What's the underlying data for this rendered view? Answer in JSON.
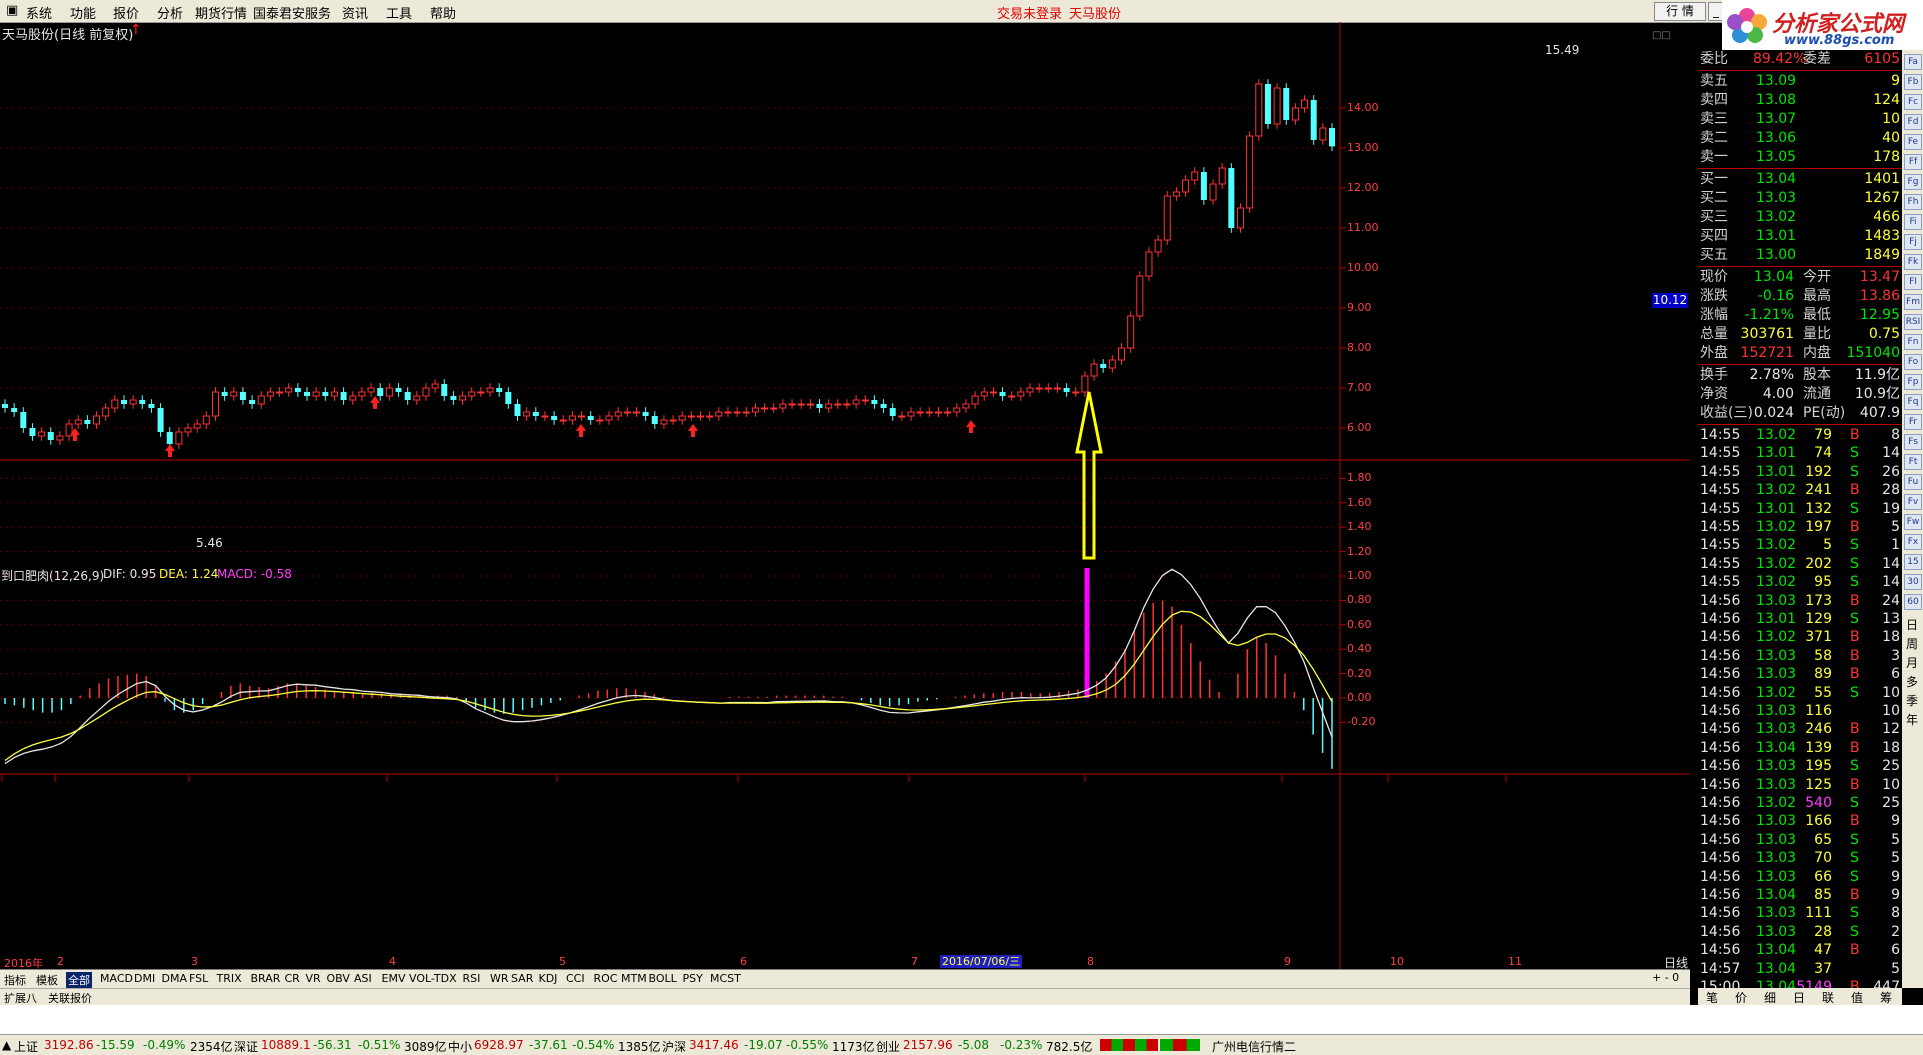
{
  "menu": {
    "items": [
      "系统",
      "功能",
      "报价",
      "分析",
      "期货行情",
      "国泰君安服务",
      "资讯",
      "工具",
      "帮助"
    ],
    "status_login": "交易未登录",
    "stock_short": "天马股份",
    "btn_quote": "行 情",
    "logo_main": "分析家公式网",
    "logo_url": "www.88gs.com"
  },
  "chart": {
    "title": "天马股份(日线 前复权)",
    "high_label": "15.49",
    "low_label": "5.46",
    "current_price_tag": "10.12",
    "price_axis": [
      "14.00",
      "13.00",
      "12.00",
      "11.00",
      "10.00",
      "9.00",
      "8.00",
      "7.00",
      "6.00"
    ],
    "macd_title": "到口肥肉(12,26,9)",
    "macd_dif": "DIF: 0.95",
    "macd_dea": "DEA: 1.24",
    "macd_macd": "MACD: -0.58",
    "macd_axis": [
      "1.80",
      "1.60",
      "1.40",
      "1.20",
      "1.00",
      "0.80",
      "0.60",
      "0.40",
      "0.20",
      "0.00",
      "-0.20"
    ],
    "date_axis": [
      "2016年",
      "2",
      "3",
      "4",
      "5",
      "6",
      "7",
      "8",
      "9",
      "10",
      "11"
    ],
    "date_cursor": "2016/07/06/三",
    "period": "日线"
  },
  "chart_data": {
    "type": "candlestick",
    "title": "天马股份(日线 前复权)",
    "price_range": [
      5.2,
      15.8
    ],
    "high": 15.49,
    "low": 5.46,
    "macd_params": "12,26,9",
    "dif": 0.95,
    "dea": 1.24,
    "macd": -0.58,
    "closes": [
      6.5,
      6.4,
      6.0,
      5.8,
      5.9,
      5.7,
      5.8,
      6.1,
      6.2,
      6.1,
      6.3,
      6.5,
      6.7,
      6.6,
      6.7,
      6.6,
      6.5,
      5.9,
      5.6,
      5.9,
      6.0,
      6.1,
      6.3,
      6.9,
      6.8,
      6.9,
      6.7,
      6.6,
      6.8,
      6.9,
      6.9,
      7.0,
      6.9,
      6.8,
      6.9,
      6.8,
      6.9,
      6.7,
      6.8,
      6.9,
      7.0,
      6.8,
      7.0,
      6.9,
      6.7,
      6.8,
      7.0,
      7.1,
      6.8,
      6.7,
      6.8,
      6.9,
      6.9,
      7.0,
      6.9,
      6.6,
      6.3,
      6.4,
      6.3,
      6.3,
      6.2,
      6.2,
      6.3,
      6.3,
      6.2,
      6.2,
      6.3,
      6.4,
      6.4,
      6.4,
      6.3,
      6.1,
      6.2,
      6.2,
      6.3,
      6.3,
      6.3,
      6.3,
      6.4,
      6.4,
      6.4,
      6.4,
      6.5,
      6.5,
      6.5,
      6.6,
      6.6,
      6.6,
      6.6,
      6.5,
      6.6,
      6.6,
      6.6,
      6.7,
      6.7,
      6.6,
      6.5,
      6.3,
      6.3,
      6.4,
      6.4,
      6.4,
      6.4,
      6.4,
      6.5,
      6.6,
      6.8,
      6.9,
      6.9,
      6.8,
      6.8,
      6.9,
      7.0,
      7.0,
      7.0,
      7.0,
      6.9,
      6.9,
      7.3,
      7.6,
      7.5,
      7.7,
      8.0,
      8.8,
      9.8,
      10.4,
      10.7,
      11.8,
      11.9,
      12.2,
      12.4,
      11.7,
      12.1,
      12.5,
      11.0,
      11.5,
      13.3,
      14.6,
      13.6,
      14.5,
      13.7,
      14.0,
      14.2,
      13.2,
      13.5,
      13.04
    ],
    "macd_hist": [
      -0.05,
      -0.06,
      -0.08,
      -0.1,
      -0.12,
      -0.12,
      -0.1,
      -0.05,
      0.02,
      0.08,
      0.12,
      0.16,
      0.18,
      0.19,
      0.2,
      0.18,
      0.1,
      -0.03,
      -0.1,
      -0.12,
      -0.1,
      -0.05,
      0,
      0.05,
      0.1,
      0.12,
      0.1,
      0.09,
      0.08,
      0.1,
      0.12,
      0.12,
      0.1,
      0.09,
      0.07,
      0.06,
      0.05,
      0.05,
      0.04,
      0.04,
      0.04,
      0.03,
      0.03,
      0.03,
      0.03,
      0.02,
      0.02,
      0.02,
      0.01,
      -0.03,
      -0.08,
      -0.1,
      -0.12,
      -0.13,
      -0.12,
      -0.1,
      -0.08,
      -0.06,
      -0.04,
      -0.02,
      0,
      0.02,
      0.04,
      0.06,
      0.07,
      0.08,
      0.08,
      0.07,
      0.05,
      0.03,
      0.01,
      0,
      0,
      0,
      0,
      0,
      0,
      0.01,
      0.01,
      0.01,
      0.01,
      0.01,
      0.02,
      0.02,
      0.02,
      0.02,
      0.02,
      0.02,
      0.01,
      0.01,
      0,
      -0.02,
      -0.04,
      -0.06,
      -0.07,
      -0.06,
      -0.05,
      -0.03,
      -0.02,
      -0.01,
      0,
      0.01,
      0.02,
      0.03,
      0.04,
      0.04,
      0.05,
      0.05,
      0.05,
      0.04,
      0.04,
      0.04,
      0.05,
      0.06,
      0.07,
      0.1,
      0.14,
      0.2,
      0.3,
      0.4,
      0.55,
      0.7,
      0.78,
      0.8,
      0.75,
      0.6,
      0.45,
      0.3,
      0.15,
      0.05,
      0,
      0.2,
      0.4,
      0.5,
      0.45,
      0.35,
      0.2,
      0.05,
      -0.1,
      -0.3,
      -0.45,
      -0.58
    ]
  },
  "panel": {
    "weibi_label": "委比",
    "weibi_value": "89.42%",
    "weicha_label": "委差",
    "weicha_value": "6105",
    "asks": [
      {
        "label": "卖五",
        "price": "13.09",
        "vol": "9"
      },
      {
        "label": "卖四",
        "price": "13.08",
        "vol": "124"
      },
      {
        "label": "卖三",
        "price": "13.07",
        "vol": "10"
      },
      {
        "label": "卖二",
        "price": "13.06",
        "vol": "40"
      },
      {
        "label": "卖一",
        "price": "13.05",
        "vol": "178"
      }
    ],
    "bids": [
      {
        "label": "买一",
        "price": "13.04",
        "vol": "1401"
      },
      {
        "label": "买二",
        "price": "13.03",
        "vol": "1267"
      },
      {
        "label": "买三",
        "price": "13.02",
        "vol": "466"
      },
      {
        "label": "买四",
        "price": "13.01",
        "vol": "1483"
      },
      {
        "label": "买五",
        "price": "13.00",
        "vol": "1849"
      }
    ],
    "stats": [
      {
        "l1": "现价",
        "v1": "13.04",
        "c1": "grn",
        "l2": "今开",
        "v2": "13.47",
        "c2": "red"
      },
      {
        "l1": "涨跌",
        "v1": "-0.16",
        "c1": "grn",
        "l2": "最高",
        "v2": "13.86",
        "c2": "red"
      },
      {
        "l1": "涨幅",
        "v1": "-1.21%",
        "c1": "grn",
        "l2": "最低",
        "v2": "12.95",
        "c2": "grn"
      },
      {
        "l1": "总量",
        "v1": "303761",
        "c1": "yel",
        "l2": "量比",
        "v2": "0.75",
        "c2": "yel"
      },
      {
        "l1": "外盘",
        "v1": "152721",
        "c1": "red",
        "l2": "内盘",
        "v2": "151040",
        "c2": "grn"
      }
    ],
    "stats2": [
      {
        "l1": "换手",
        "v1": "2.78%",
        "l2": "股本",
        "v2": "11.9亿"
      },
      {
        "l1": "净资",
        "v1": "4.00",
        "l2": "流通",
        "v2": "10.9亿"
      },
      {
        "l1": "收益(三)",
        "v1": "0.024",
        "l2": "PE(动)",
        "v2": "407.9"
      }
    ],
    "ticks": [
      {
        "t": "14:55",
        "p": "13.02",
        "v": "79",
        "d": "B",
        "n": "8"
      },
      {
        "t": "14:55",
        "p": "13.01",
        "v": "74",
        "d": "S",
        "n": "14"
      },
      {
        "t": "14:55",
        "p": "13.01",
        "v": "192",
        "d": "S",
        "n": "26"
      },
      {
        "t": "14:55",
        "p": "13.02",
        "v": "241",
        "d": "B",
        "n": "28"
      },
      {
        "t": "14:55",
        "p": "13.01",
        "v": "132",
        "d": "S",
        "n": "19"
      },
      {
        "t": "14:55",
        "p": "13.02",
        "v": "197",
        "d": "B",
        "n": "5"
      },
      {
        "t": "14:55",
        "p": "13.02",
        "v": "5",
        "d": "S",
        "n": "1"
      },
      {
        "t": "14:55",
        "p": "13.02",
        "v": "202",
        "d": "S",
        "n": "14"
      },
      {
        "t": "14:55",
        "p": "13.02",
        "v": "95",
        "d": "S",
        "n": "14"
      },
      {
        "t": "14:56",
        "p": "13.03",
        "v": "173",
        "d": "B",
        "n": "24"
      },
      {
        "t": "14:56",
        "p": "13.01",
        "v": "129",
        "d": "S",
        "n": "13"
      },
      {
        "t": "14:56",
        "p": "13.02",
        "v": "371",
        "d": "B",
        "n": "18"
      },
      {
        "t": "14:56",
        "p": "13.03",
        "v": "58",
        "d": "B",
        "n": "3"
      },
      {
        "t": "14:56",
        "p": "13.03",
        "v": "89",
        "d": "B",
        "n": "6"
      },
      {
        "t": "14:56",
        "p": "13.02",
        "v": "55",
        "d": "S",
        "n": "10"
      },
      {
        "t": "14:56",
        "p": "13.03",
        "v": "116",
        "d": "",
        "n": "10"
      },
      {
        "t": "14:56",
        "p": "13.03",
        "v": "246",
        "d": "B",
        "n": "12"
      },
      {
        "t": "14:56",
        "p": "13.04",
        "v": "139",
        "d": "B",
        "n": "18"
      },
      {
        "t": "14:56",
        "p": "13.03",
        "v": "195",
        "d": "S",
        "n": "25"
      },
      {
        "t": "14:56",
        "p": "13.03",
        "v": "125",
        "d": "B",
        "n": "10"
      },
      {
        "t": "14:56",
        "p": "13.02",
        "v": "540",
        "d": "S",
        "n": "25"
      },
      {
        "t": "14:56",
        "p": "13.03",
        "v": "166",
        "d": "B",
        "n": "9"
      },
      {
        "t": "14:56",
        "p": "13.03",
        "v": "65",
        "d": "S",
        "n": "5"
      },
      {
        "t": "14:56",
        "p": "13.03",
        "v": "70",
        "d": "S",
        "n": "5"
      },
      {
        "t": "14:56",
        "p": "13.03",
        "v": "66",
        "d": "S",
        "n": "9"
      },
      {
        "t": "14:56",
        "p": "13.04",
        "v": "85",
        "d": "B",
        "n": "9"
      },
      {
        "t": "14:56",
        "p": "13.03",
        "v": "111",
        "d": "S",
        "n": "8"
      },
      {
        "t": "14:56",
        "p": "13.03",
        "v": "28",
        "d": "S",
        "n": "2"
      },
      {
        "t": "14:56",
        "p": "13.04",
        "v": "47",
        "d": "B",
        "n": "6"
      },
      {
        "t": "14:57",
        "p": "13.04",
        "v": "37",
        "d": "",
        "n": "5"
      },
      {
        "t": "15:00",
        "p": "13.04",
        "v": "5149",
        "d": "B",
        "n": "447"
      }
    ],
    "tabs": [
      "笔",
      "价",
      "细",
      "日",
      "联",
      "值",
      "筹"
    ]
  },
  "sidebar_text": [
    "日",
    "周",
    "月",
    "多",
    "季",
    "年"
  ],
  "sidebar_icons": [
    "Fa",
    "Fb",
    "Fc",
    "Fd",
    "Fe",
    "Ff",
    "Fg",
    "Fh",
    "Fi",
    "Fj",
    "Fk",
    "Fl",
    "Fm",
    "RSI",
    "Fn",
    "Fo",
    "Fp",
    "Fq",
    "Fr",
    "Fs",
    "Ft",
    "Fu",
    "Fv",
    "Fw",
    "Fx",
    "15",
    "30",
    "60"
  ],
  "indicator_tabs": [
    "指标",
    "模板",
    "全部",
    "MACD",
    "DMI",
    "DMA",
    "FSL",
    "TRIX",
    "BRAR",
    "CR",
    "VR",
    "OBV",
    "ASI",
    "EMV",
    "VOL-TDX",
    "RSI",
    "WR",
    "SAR",
    "KDJ",
    "CCI",
    "ROC",
    "MTM",
    "BOLL",
    "PSY",
    "MCST"
  ],
  "bottom_tabs": [
    "扩展八",
    "关联报价"
  ],
  "status": {
    "sh_label": "上证",
    "sh_val": "3192.86",
    "sh_chg": "-15.59",
    "sh_pct": "-0.49%",
    "sh_amt": "2354亿",
    "sz_label": "深证",
    "sz_val": "10889.1",
    "sz_chg": "-56.31",
    "sz_pct": "-0.51%",
    "sz_amt": "3089亿",
    "zx_label": "中小",
    "zx_val": "6928.97",
    "zx_chg": "-37.61",
    "zx_pct": "-0.54%",
    "zx_amt": "1385亿",
    "hs_label": "沪深",
    "hs_val": "3417.46",
    "hs_chg": "-19.07",
    "hs_pct": "-0.55%",
    "hs_amt": "1173亿",
    "cy_label": "创业",
    "cy_val": "2157.96",
    "cy_chg": "-5.08",
    "cy_pct": "-0.23%",
    "cy_amt": "782.5亿",
    "server": "广州电信行情二"
  }
}
